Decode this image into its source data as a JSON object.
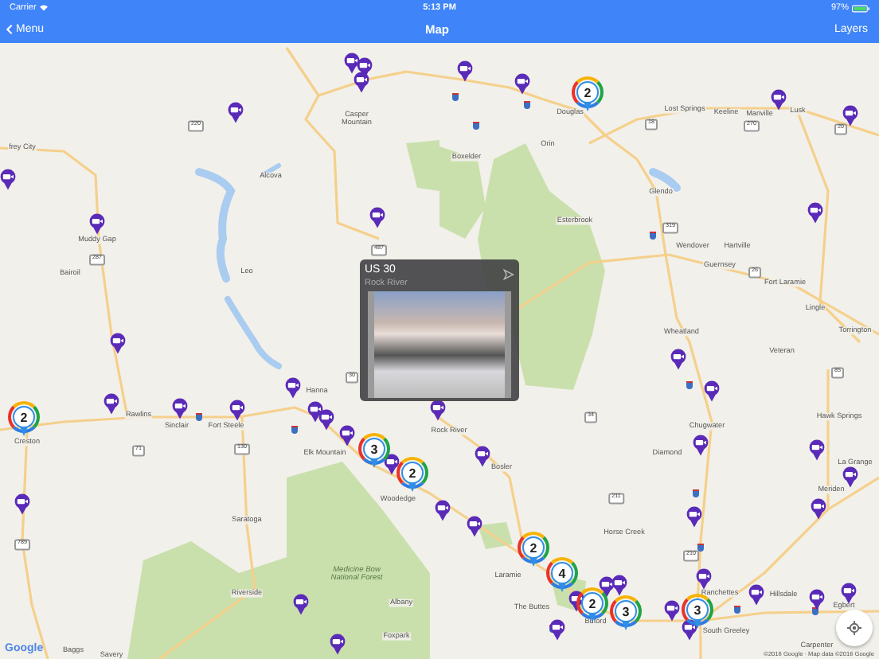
{
  "status_bar": {
    "carrier": "Carrier",
    "time": "5:13 PM",
    "battery": "97%"
  },
  "nav_bar": {
    "back": "Menu",
    "title": "Map",
    "right_button": "Layers"
  },
  "map": {
    "places": [
      {
        "name": "frey City"
      },
      {
        "name": "Muddy Gap"
      },
      {
        "name": "Bairoil"
      },
      {
        "name": "Alcova"
      },
      {
        "name": "Leo"
      },
      {
        "name": "Casper Mountain"
      },
      {
        "name": "Douglas"
      },
      {
        "name": "Orin"
      },
      {
        "name": "Lost Springs"
      },
      {
        "name": "Keeline"
      },
      {
        "name": "Manville"
      },
      {
        "name": "Lusk"
      },
      {
        "name": "Boxelder"
      },
      {
        "name": "Esterbrook"
      },
      {
        "name": "Glendo"
      },
      {
        "name": "Wendover"
      },
      {
        "name": "Hartville"
      },
      {
        "name": "Guernsey"
      },
      {
        "name": "Fort Laramie"
      },
      {
        "name": "Lingle"
      },
      {
        "name": "Torrington"
      },
      {
        "name": "Wheatland"
      },
      {
        "name": "Veteran"
      },
      {
        "name": "Hawk Springs"
      },
      {
        "name": "La Grange"
      },
      {
        "name": "Meriden"
      },
      {
        "name": "Chugwater"
      },
      {
        "name": "Diamond"
      },
      {
        "name": "Bosler"
      },
      {
        "name": "Horse Creek"
      },
      {
        "name": "Hillsdale"
      },
      {
        "name": "Egbert"
      },
      {
        "name": "Carpenter"
      },
      {
        "name": "Ranchettes"
      },
      {
        "name": "South Greeley"
      },
      {
        "name": "Laramie"
      },
      {
        "name": "The Buttes"
      },
      {
        "name": "Buford"
      },
      {
        "name": "Rock River"
      },
      {
        "name": "Woodedge"
      },
      {
        "name": "Elk Mountain"
      },
      {
        "name": "Hanna"
      },
      {
        "name": "Rawlins"
      },
      {
        "name": "Sinclair"
      },
      {
        "name": "Fort Steele"
      },
      {
        "name": "Creston"
      },
      {
        "name": "Saratoga"
      },
      {
        "name": "Riverside"
      },
      {
        "name": "Albany"
      },
      {
        "name": "Foxpark"
      },
      {
        "name": "Baggs"
      },
      {
        "name": "Savery"
      }
    ],
    "forest_label": "Medicine Bow National Forest",
    "route_shields": [
      {
        "number": "287"
      },
      {
        "number": "220"
      },
      {
        "number": "487"
      },
      {
        "number": "18"
      },
      {
        "number": "270"
      },
      {
        "number": "20"
      },
      {
        "number": "319"
      },
      {
        "number": "26"
      },
      {
        "number": "85"
      },
      {
        "number": "30"
      },
      {
        "number": "130"
      },
      {
        "number": "71"
      },
      {
        "number": "789"
      },
      {
        "number": "34"
      },
      {
        "number": "211"
      },
      {
        "number": "210"
      }
    ],
    "clusters": [
      {
        "count": "2"
      },
      {
        "count": "2"
      },
      {
        "count": "3"
      },
      {
        "count": "2"
      },
      {
        "count": "2"
      },
      {
        "count": "4"
      },
      {
        "count": "2"
      },
      {
        "count": "3"
      },
      {
        "count": "3"
      }
    ],
    "camera_popup": {
      "title": "US 30",
      "subtitle": "Rock River"
    },
    "logo": "Google",
    "attribution": "©2016 Google · Map data ©2016 Google"
  }
}
